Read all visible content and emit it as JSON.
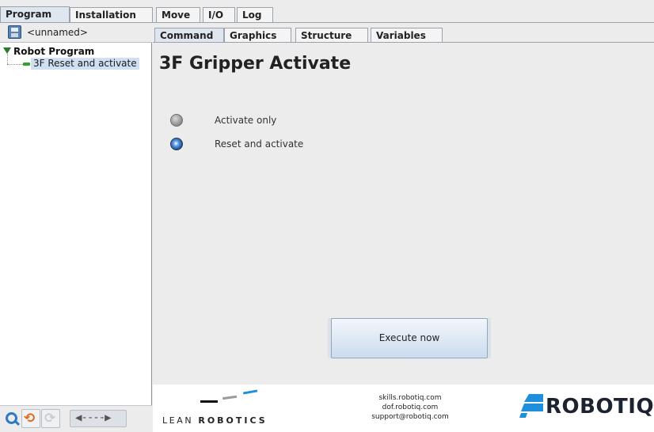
{
  "top_tabs": {
    "group1": [
      {
        "label": "Program",
        "active": true
      },
      {
        "label": "Installation",
        "active": false
      }
    ],
    "group2": [
      {
        "label": "Move",
        "active": false
      },
      {
        "label": "I/O",
        "active": false
      },
      {
        "label": "Log",
        "active": false
      }
    ]
  },
  "program": {
    "file_name": "<unnamed>",
    "tree": {
      "root": "Robot Program",
      "selected_child": "3F Reset and activate"
    }
  },
  "sub_tabs": [
    {
      "label": "Command",
      "active": true
    },
    {
      "label": "Graphics",
      "active": false
    },
    {
      "label": "Structure",
      "active": false
    },
    {
      "label": "Variables",
      "active": false
    }
  ],
  "command": {
    "title": "3F Gripper Activate",
    "options": [
      {
        "label": "Activate only",
        "selected": false
      },
      {
        "label": "Reset and activate",
        "selected": true
      }
    ],
    "execute_label": "Execute now"
  },
  "footer": {
    "lean_prefix": "LEAN",
    "lean_word": "ROBOTICS",
    "links": [
      "skills.robotiq.com",
      "dof.robotiq.com",
      "support@robotiq.com"
    ],
    "brand": "ROBOTIQ"
  },
  "colors": {
    "accent_blue": "#2e78c8",
    "robotiq_blue": "#1e8fdc",
    "tree_green": "#2ea32e",
    "undo_orange": "#e06a1b"
  },
  "icons": [
    "save-icon",
    "search-icon",
    "undo-icon",
    "redo-icon",
    "nav-arrows-icon",
    "tree-expand-icon"
  ]
}
